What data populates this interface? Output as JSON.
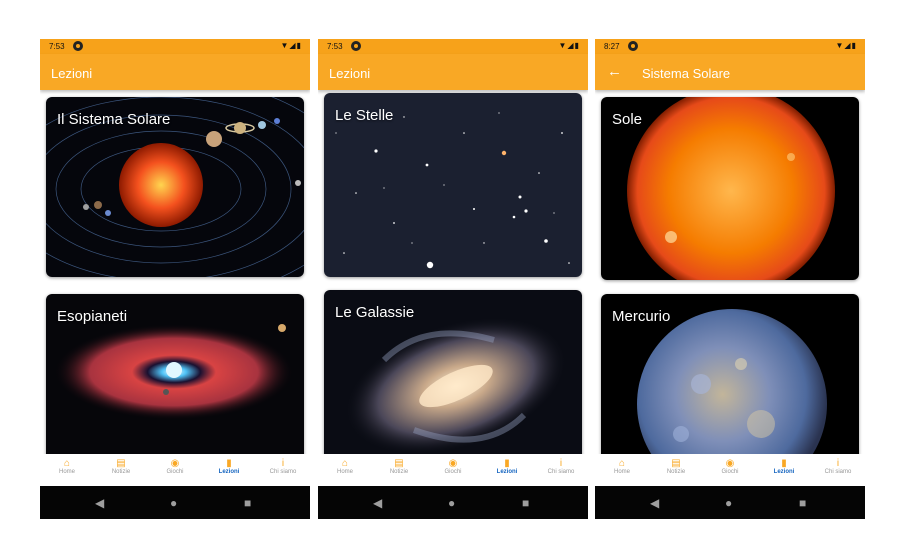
{
  "screens": [
    {
      "status": {
        "time": "7:53",
        "icons": "▼◢▮"
      },
      "appbar": {
        "title": "Lezioni",
        "has_back": false
      },
      "cards": [
        {
          "label": "Il Sistema Solare"
        },
        {
          "label": "Esopianeti"
        }
      ],
      "nav": [
        {
          "icon": "⌂",
          "label": "Home"
        },
        {
          "icon": "▤",
          "label": "Notizie"
        },
        {
          "icon": "◉",
          "label": "Giochi"
        },
        {
          "icon": "▮",
          "label": "Lezioni"
        },
        {
          "icon": "i",
          "label": "Chi siamo"
        }
      ],
      "active_tab": 3
    },
    {
      "status": {
        "time": "7:53",
        "icons": "▼◢▮"
      },
      "appbar": {
        "title": "Lezioni",
        "has_back": false
      },
      "cards": [
        {
          "label": "Le Stelle"
        },
        {
          "label": "Le Galassie"
        }
      ],
      "nav": [
        {
          "icon": "⌂",
          "label": "Home"
        },
        {
          "icon": "▤",
          "label": "Notizie"
        },
        {
          "icon": "◉",
          "label": "Giochi"
        },
        {
          "icon": "▮",
          "label": "Lezioni"
        },
        {
          "icon": "i",
          "label": "Chi siamo"
        }
      ],
      "active_tab": 3
    },
    {
      "status": {
        "time": "8:27",
        "icons": "▼◢▮"
      },
      "appbar": {
        "title": "Sistema Solare",
        "has_back": true,
        "back_icon": "←"
      },
      "cards": [
        {
          "label": "Sole"
        },
        {
          "label": "Mercurio"
        }
      ],
      "nav": [
        {
          "icon": "⌂",
          "label": "Home"
        },
        {
          "icon": "▤",
          "label": "Notizie"
        },
        {
          "icon": "◉",
          "label": "Giochi"
        },
        {
          "icon": "▮",
          "label": "Lezioni"
        },
        {
          "icon": "i",
          "label": "Chi siamo"
        }
      ],
      "active_tab": 3
    }
  ],
  "system_nav": {
    "back": "◀",
    "home": "●",
    "recents": "■"
  },
  "colors": {
    "accent": "#f9a825",
    "active_tab": "#1565c0"
  }
}
